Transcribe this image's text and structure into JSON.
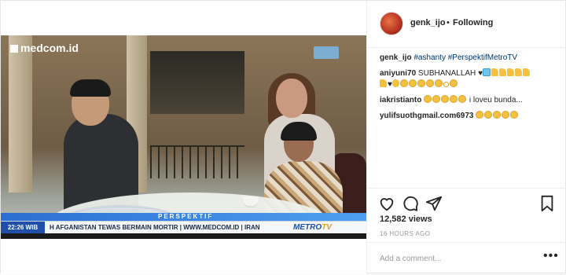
{
  "header": {
    "username": "genk_ijo",
    "separator": "•",
    "follow_label": "Following"
  },
  "video": {
    "channel_logo": "medcom.id",
    "banner_label": "PERSPEKTIF",
    "ticker_time": "22:26 WIB",
    "ticker_text": "H AFGANISTAN TEWAS BERMAIN MORTIR  |  WWW.MEDCOM.ID  |  IRAN",
    "network_logo_main": "METRO",
    "network_logo_accent": "TV"
  },
  "caption": {
    "username": "genk_ijo",
    "text": "#ashanty #PerspektifMetroTV"
  },
  "comments": [
    {
      "username": "aniyuni70",
      "text": "SUBHANALLAH"
    },
    {
      "username": "iakristianto",
      "text": "i loveu bunda..."
    },
    {
      "username": "yulifsuothgmail.com6973",
      "text": ""
    }
  ],
  "stats": {
    "views": "12,582 views",
    "time_ago": "16 HOURS AGO"
  },
  "add_comment": {
    "placeholder": "Add a comment...",
    "more": "•••"
  },
  "colors": {
    "accent_blue": "#1f4fa8",
    "banner_blue": "#2a6fd1",
    "link": "#003569"
  }
}
